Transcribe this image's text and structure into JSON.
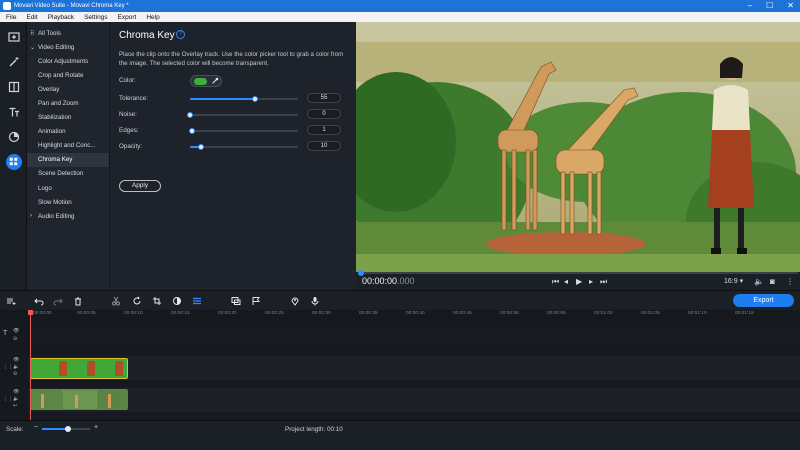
{
  "window": {
    "title": "Movavi Video Suite - Movavi Chroma Key *",
    "minimize": "–",
    "maximize": "☐",
    "close": "✕"
  },
  "menu": [
    "File",
    "Edit",
    "Playback",
    "Settings",
    "Export",
    "Help"
  ],
  "toolrail": [
    "import-icon",
    "filters-icon",
    "transitions-icon",
    "titles-icon",
    "stickers-icon",
    "more-tools-icon"
  ],
  "sidebar": {
    "all_tools": "All Tools",
    "video_editing": "Video Editing",
    "items": [
      "Color Adjustments",
      "Crop and Rotate",
      "Overlay",
      "Pan and Zoom",
      "Stabilization",
      "Animation",
      "Highlight and Conc...",
      "Chroma Key",
      "Scene Detection",
      "Logo",
      "Slow Motion"
    ],
    "audio_editing": "Audio Editing"
  },
  "panel": {
    "title": "Chroma Key",
    "description": "Place the clip onto the Overlay track. Use the color picker tool to grab a color from the image. The selected color will become transparent.",
    "color_label": "Color:",
    "key_color": "#3fae3b",
    "params": [
      {
        "label": "Tolerance:",
        "value": "55",
        "fraction": 0.6
      },
      {
        "label": "Noise:",
        "value": "0",
        "fraction": 0.0
      },
      {
        "label": "Edges:",
        "value": "1",
        "fraction": 0.02
      },
      {
        "label": "Opacity:",
        "value": "10",
        "fraction": 0.1
      }
    ],
    "apply": "Apply"
  },
  "player": {
    "time": "00:00:00",
    "ms": ".000",
    "aspect": "16:9 ▾",
    "progress": 0.0
  },
  "toolbar": {
    "export": "Export"
  },
  "ruler": [
    "00:00:00",
    "00:00:05",
    "00:00:10",
    "00:00:15",
    "00:00:20",
    "00:00:25",
    "00:00:30",
    "00:00:35",
    "00:00:40",
    "00:00:45",
    "00:00:50",
    "00:00:55",
    "00:01:00",
    "00:01:05",
    "00:01:10",
    "00:01:15"
  ],
  "status": {
    "scale_label": "Scale:",
    "project_length": "Project length:  00:10"
  }
}
